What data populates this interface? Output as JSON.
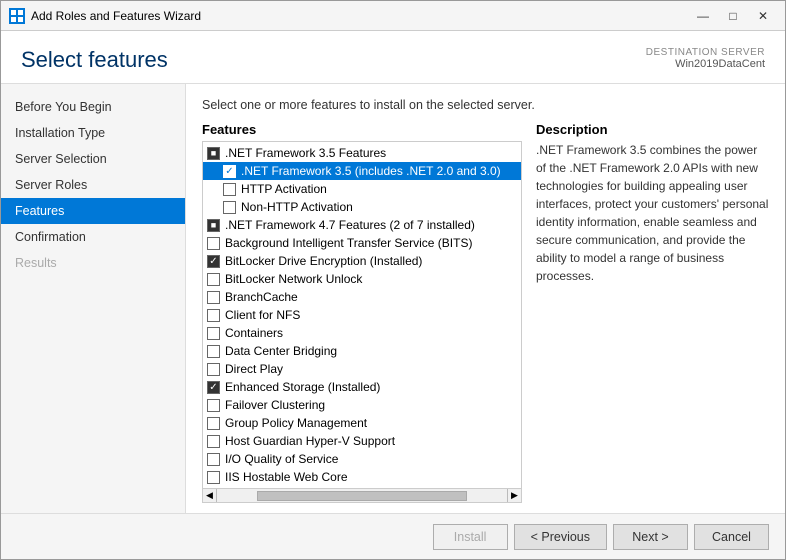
{
  "window": {
    "title": "Add Roles and Features Wizard"
  },
  "header": {
    "page_title": "Select features",
    "destination_label": "DESTINATION SERVER",
    "destination_server": "Win2019DataCent"
  },
  "sidebar": {
    "items": [
      {
        "id": "before-you-begin",
        "label": "Before You Begin",
        "state": "normal"
      },
      {
        "id": "installation-type",
        "label": "Installation Type",
        "state": "normal"
      },
      {
        "id": "server-selection",
        "label": "Server Selection",
        "state": "normal"
      },
      {
        "id": "server-roles",
        "label": "Server Roles",
        "state": "normal"
      },
      {
        "id": "features",
        "label": "Features",
        "state": "active"
      },
      {
        "id": "confirmation",
        "label": "Confirmation",
        "state": "normal"
      },
      {
        "id": "results",
        "label": "Results",
        "state": "disabled"
      }
    ]
  },
  "main": {
    "instruction": "Select one or more features to install on the selected server.",
    "features_label": "Features",
    "description_label": "Description",
    "description_text": ".NET Framework 3.5 combines the power of the .NET Framework 2.0 APIs with new technologies for building appealing user interfaces, protect your customers' personal identity information, enable seamless and secure communication, and provide the ability to model a range of business processes.",
    "features": [
      {
        "id": "net35-features",
        "label": ".NET Framework 3.5 Features",
        "indent": 0,
        "check": "indeterminate",
        "selected": false
      },
      {
        "id": "net35",
        "label": ".NET Framework 3.5 (includes .NET 2.0 and 3.0)",
        "indent": 1,
        "check": "checked",
        "selected": true
      },
      {
        "id": "http-activation",
        "label": "HTTP Activation",
        "indent": 1,
        "check": "unchecked",
        "selected": false
      },
      {
        "id": "non-http-activation",
        "label": "Non-HTTP Activation",
        "indent": 1,
        "check": "unchecked",
        "selected": false
      },
      {
        "id": "net47-features",
        "label": ".NET Framework 4.7 Features (2 of 7 installed)",
        "indent": 0,
        "check": "indeterminate",
        "selected": false
      },
      {
        "id": "bits",
        "label": "Background Intelligent Transfer Service (BITS)",
        "indent": 0,
        "check": "unchecked",
        "selected": false
      },
      {
        "id": "bitlocker-drive",
        "label": "BitLocker Drive Encryption (Installed)",
        "indent": 0,
        "check": "checked-dark",
        "selected": false
      },
      {
        "id": "bitlocker-network",
        "label": "BitLocker Network Unlock",
        "indent": 0,
        "check": "unchecked",
        "selected": false
      },
      {
        "id": "branchcache",
        "label": "BranchCache",
        "indent": 0,
        "check": "unchecked",
        "selected": false
      },
      {
        "id": "client-for-nfs",
        "label": "Client for NFS",
        "indent": 0,
        "check": "unchecked",
        "selected": false
      },
      {
        "id": "containers",
        "label": "Containers",
        "indent": 0,
        "check": "unchecked",
        "selected": false
      },
      {
        "id": "data-center-bridging",
        "label": "Data Center Bridging",
        "indent": 0,
        "check": "unchecked",
        "selected": false
      },
      {
        "id": "direct-play",
        "label": "Direct Play",
        "indent": 0,
        "check": "unchecked",
        "selected": false
      },
      {
        "id": "enhanced-storage",
        "label": "Enhanced Storage (Installed)",
        "indent": 0,
        "check": "checked-dark",
        "selected": false
      },
      {
        "id": "failover-clustering",
        "label": "Failover Clustering",
        "indent": 0,
        "check": "unchecked",
        "selected": false
      },
      {
        "id": "group-policy",
        "label": "Group Policy Management",
        "indent": 0,
        "check": "unchecked",
        "selected": false
      },
      {
        "id": "host-guardian",
        "label": "Host Guardian Hyper-V Support",
        "indent": 0,
        "check": "unchecked",
        "selected": false
      },
      {
        "id": "io-quality",
        "label": "I/O Quality of Service",
        "indent": 0,
        "check": "unchecked",
        "selected": false
      },
      {
        "id": "iis-hostable",
        "label": "IIS Hostable Web Core",
        "indent": 0,
        "check": "unchecked",
        "selected": false
      }
    ]
  },
  "footer": {
    "previous_label": "< Previous",
    "next_label": "Next >",
    "install_label": "Install",
    "cancel_label": "Cancel"
  },
  "colors": {
    "accent": "#0078d7",
    "active_sidebar": "#0078d7"
  }
}
